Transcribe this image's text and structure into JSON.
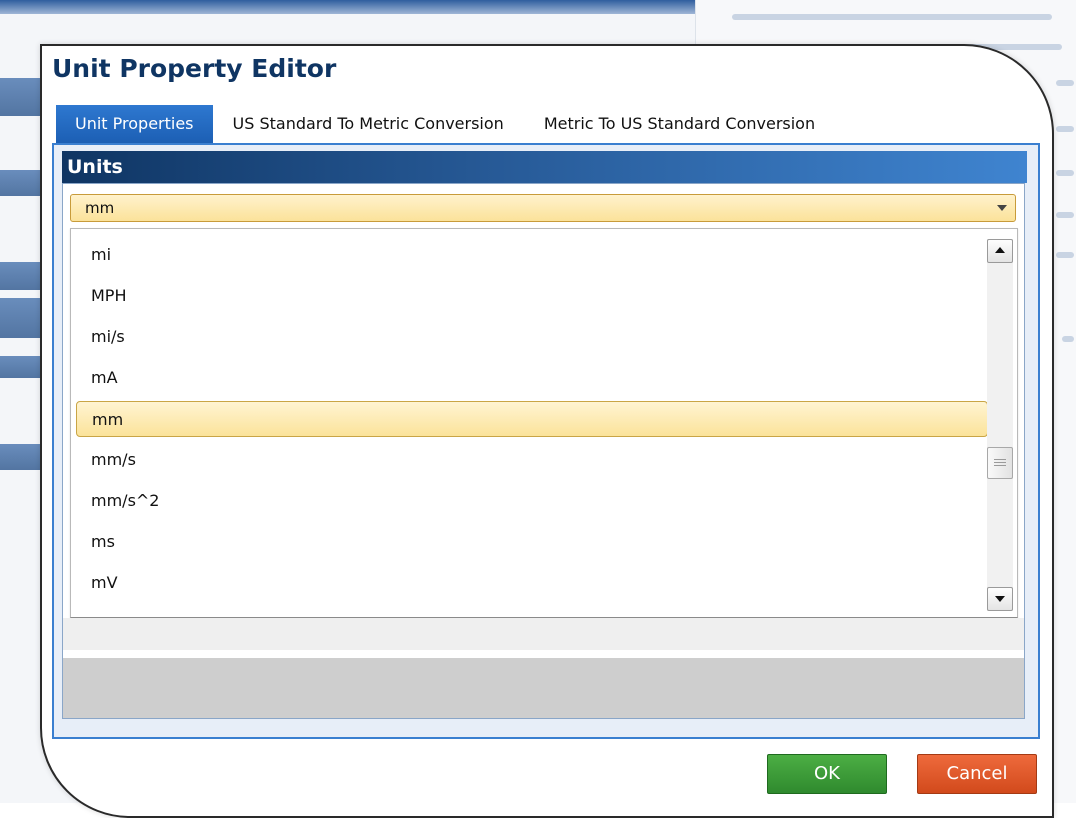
{
  "dialog": {
    "title": "Unit Property Editor"
  },
  "tabs": [
    {
      "label": "Unit Properties",
      "active": true
    },
    {
      "label": "US Standard To Metric Conversion",
      "active": false
    },
    {
      "label": "Metric To US Standard Conversion",
      "active": false
    }
  ],
  "units_panel": {
    "header": "Units",
    "selected_value": "mm",
    "list_items": [
      "mi",
      "MPH",
      "mi/s",
      "mA",
      "mm",
      "mm/s",
      "mm/s^2",
      "ms",
      "mV"
    ],
    "selected_index": 4
  },
  "buttons": {
    "ok_label": "OK",
    "cancel_label": "Cancel"
  },
  "colors": {
    "title": "#0f3563",
    "tab_active": "#1c5fb4",
    "selection": "#fbe39a",
    "ok": "#2f8a2e",
    "cancel": "#d24a1c"
  },
  "icons": {
    "combo_arrow": "chevron-down-icon",
    "scroll_up": "arrow-up-icon",
    "scroll_down": "arrow-down-icon"
  }
}
